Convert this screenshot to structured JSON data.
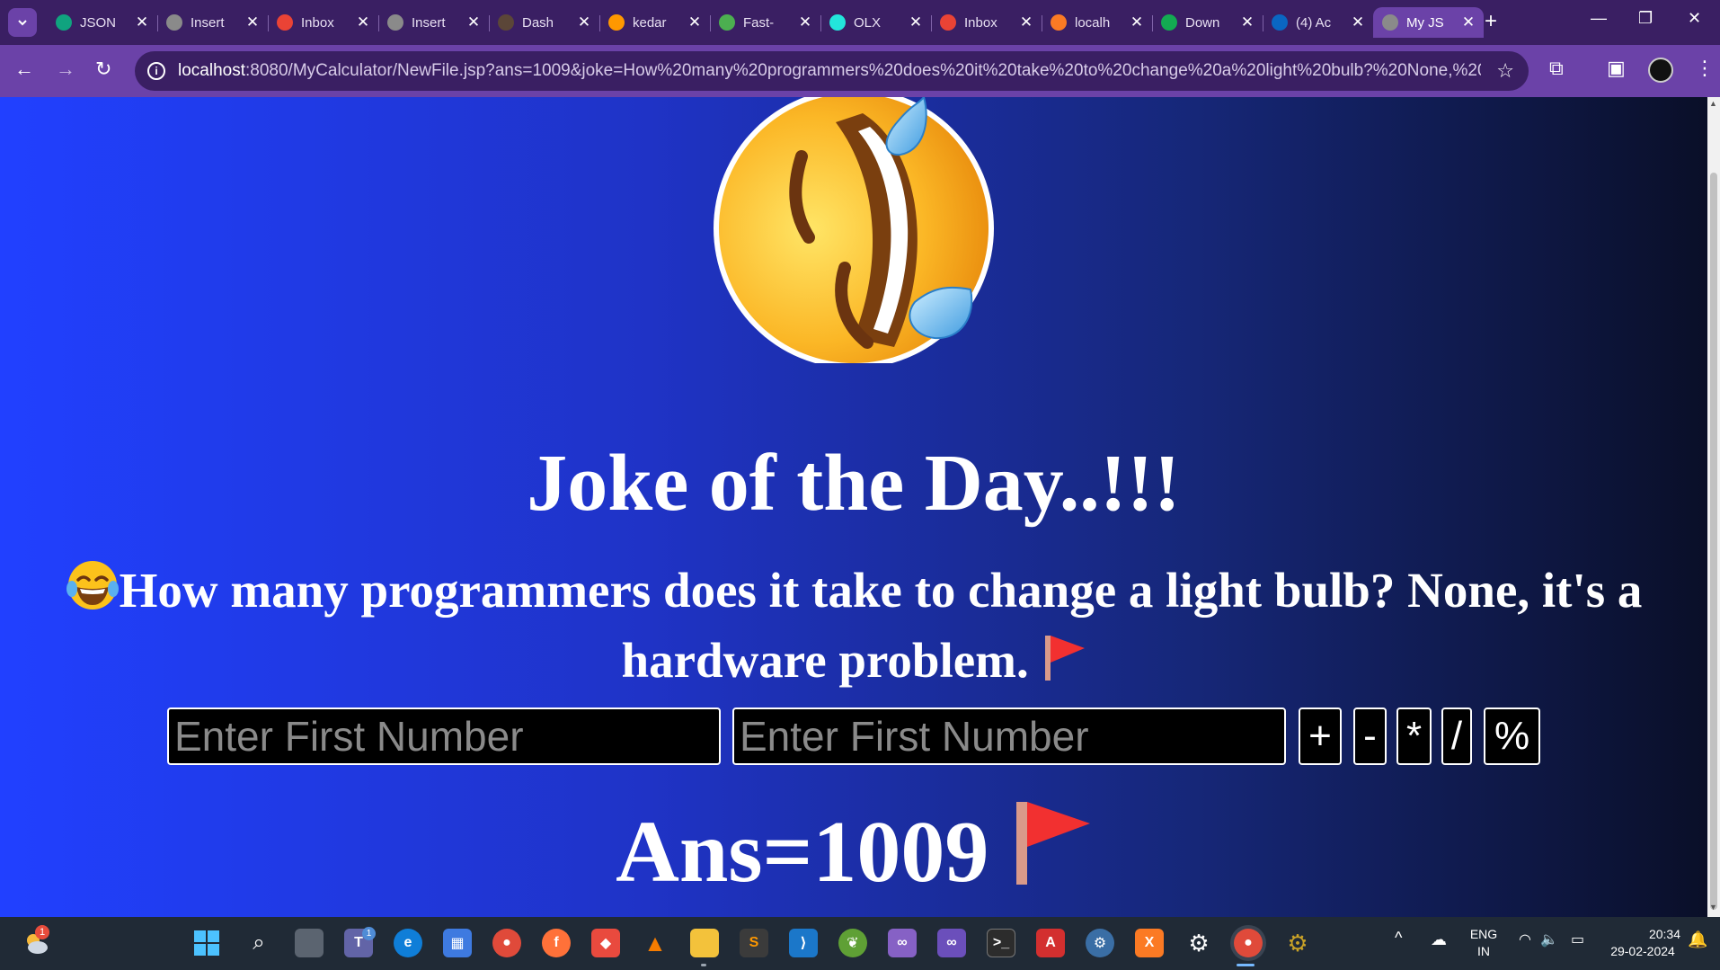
{
  "browser": {
    "tabs": [
      {
        "title": "JSON",
        "favicon": "chatgpt-icon",
        "color": "#10a37f"
      },
      {
        "title": "Insert",
        "favicon": "globe-icon",
        "color": "#8a8a8a"
      },
      {
        "title": "Inbox",
        "favicon": "gmail-icon",
        "color": "#ea4335"
      },
      {
        "title": "Insert",
        "favicon": "globe-icon",
        "color": "#8a8a8a"
      },
      {
        "title": "Dash",
        "favicon": "codechef-icon",
        "color": "#5b4638"
      },
      {
        "title": "kedar",
        "favicon": "sublime-icon",
        "color": "#ff9800"
      },
      {
        "title": "Fast-",
        "favicon": "mountain-icon",
        "color": "#4caf50"
      },
      {
        "title": "OLX",
        "favicon": "olx-icon",
        "color": "#23e5db"
      },
      {
        "title": "Inbox",
        "favicon": "gmail-icon",
        "color": "#ea4335"
      },
      {
        "title": "localh",
        "favicon": "xampp-icon",
        "color": "#fb7a24"
      },
      {
        "title": "Down",
        "favicon": "mongodb-icon",
        "color": "#13aa52"
      },
      {
        "title": "(4) Ac",
        "favicon": "linkedin-icon",
        "color": "#0a66c2"
      },
      {
        "title": "My JS",
        "favicon": "globe-icon",
        "color": "#8a8a8a",
        "active": true
      }
    ],
    "url_host": "localhost",
    "url_path": ":8080/MyCalculator/NewFile.jsp?ans=1009&joke=How%20many%20programmers%20does%20it%20take%20to%20change%20a%20light%20bulb?%20None,%20it%27s%20a%2..."
  },
  "page": {
    "heading": "Joke of the Day..!!!",
    "joke_text": "How many programmers does it take to change a light bulb? None, it's a hardware problem.",
    "joke_prefix_emoji": "😂",
    "joke_suffix_emoji": "🚩",
    "first_input_placeholder": "Enter First Number",
    "second_input_placeholder": "Enter First Number",
    "operators": [
      "+",
      "-",
      "*",
      "/",
      "%"
    ],
    "answer_text": "Ans=1009",
    "answer_emoji": "🚩",
    "background_colors": [
      "#2140ff",
      "#0a0f28"
    ]
  },
  "taskbar": {
    "weather_badge": "1",
    "teams_badge": "1",
    "lang_line1": "ENG",
    "lang_line2": "IN",
    "time": "20:34",
    "date": "29-02-2024"
  }
}
